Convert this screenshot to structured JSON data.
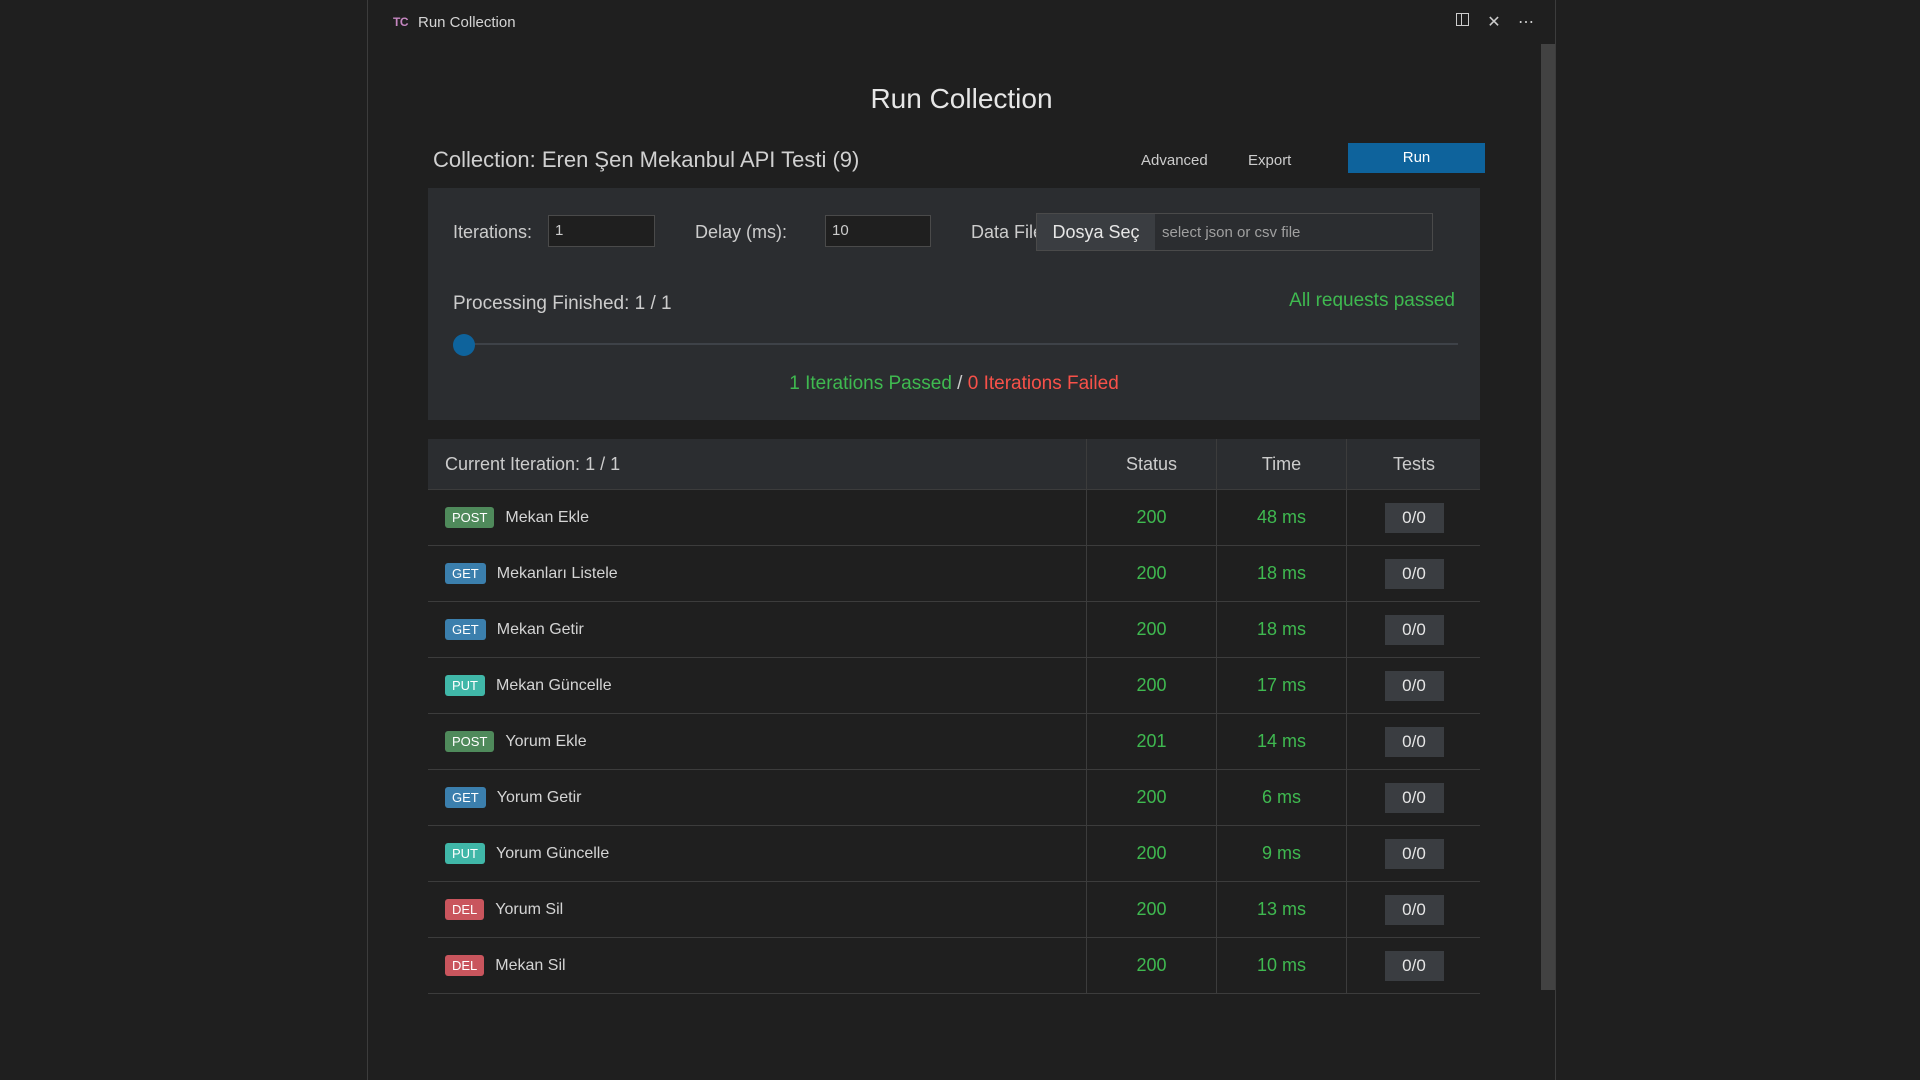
{
  "tab": {
    "icon": "TC",
    "title": "Run Collection"
  },
  "page": {
    "title": "Run Collection"
  },
  "collection": {
    "label": "Collection: Eren Şen Mekanbul API Testi (9)",
    "advanced": "Advanced",
    "export": "Export",
    "run": "Run"
  },
  "options": {
    "iterations_label": "Iterations:",
    "iterations_value": "1",
    "delay_label": "Delay (ms):",
    "delay_value": "10",
    "datafile_label": "Data File:",
    "file_button": "Dosya Seç",
    "file_placeholder": "select json or csv file"
  },
  "progress": {
    "processing": "Processing Finished: 1 / 1",
    "all_passed": "All requests passed",
    "passed": "1 Iterations Passed",
    "separator": " / ",
    "failed": "0 Iterations Failed"
  },
  "results": {
    "header": {
      "name": "Current Iteration: 1 / 1",
      "status": "Status",
      "time": "Time",
      "tests": "Tests"
    },
    "rows": [
      {
        "method": "POST",
        "name": "Mekan Ekle",
        "status": "200",
        "time": "48 ms",
        "tests": "0/0"
      },
      {
        "method": "GET",
        "name": "Mekanları Listele",
        "status": "200",
        "time": "18 ms",
        "tests": "0/0"
      },
      {
        "method": "GET",
        "name": "Mekan Getir",
        "status": "200",
        "time": "18 ms",
        "tests": "0/0"
      },
      {
        "method": "PUT",
        "name": "Mekan Güncelle",
        "status": "200",
        "time": "17 ms",
        "tests": "0/0"
      },
      {
        "method": "POST",
        "name": "Yorum Ekle",
        "status": "201",
        "time": "14 ms",
        "tests": "0/0"
      },
      {
        "method": "GET",
        "name": "Yorum Getir",
        "status": "200",
        "time": "6 ms",
        "tests": "0/0"
      },
      {
        "method": "PUT",
        "name": "Yorum Güncelle",
        "status": "200",
        "time": "9 ms",
        "tests": "0/0"
      },
      {
        "method": "DEL",
        "name": "Yorum Sil",
        "status": "200",
        "time": "13 ms",
        "tests": "0/0"
      },
      {
        "method": "DEL",
        "name": "Mekan Sil",
        "status": "200",
        "time": "10 ms",
        "tests": "0/0"
      }
    ]
  },
  "colors": {
    "accent": "#0e639c",
    "pass": "#3fb950",
    "fail": "#f85149"
  }
}
